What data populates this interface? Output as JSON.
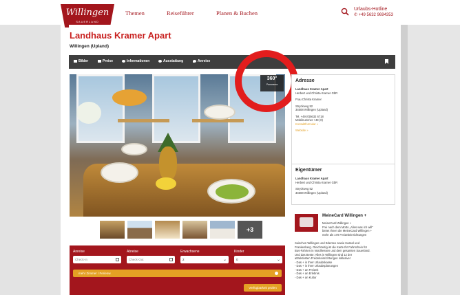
{
  "header": {
    "logo_name": "Willingen",
    "logo_sub": "SAUERLAND",
    "nav": [
      "Themen",
      "Reiseführer",
      "Planen & Buchen"
    ],
    "hotline_label": "Urlaubs-Hotline",
    "hotline_phone": "+49 5632 9694353",
    "icons": {
      "search": "search-icon",
      "phone": "phone-icon"
    }
  },
  "listing": {
    "title": "Landhaus Kramer Apart",
    "location": "Willingen (Upland)"
  },
  "tabs": [
    {
      "label": "Bilder",
      "icon": "image-icon"
    },
    {
      "label": "Preise",
      "icon": "price-icon"
    },
    {
      "label": "Informationen",
      "icon": "info-icon"
    },
    {
      "label": "Ausstattung",
      "icon": "settings-icon"
    },
    {
      "label": "Anreise",
      "icon": "location-icon"
    }
  ],
  "gallery": {
    "panorama_label": "360°",
    "panorama_sub": "Panorama",
    "more_count": "+3"
  },
  "booking": {
    "labels": [
      "Anreise",
      "Abreise",
      "Erwachsene",
      "Kinder"
    ],
    "checkin_placeholder": "Check-In",
    "checkout_placeholder": "Check-Out",
    "adults_value": "2",
    "children_value": "0",
    "more_rooms": "mehr Zimmer / Ferienw.",
    "check_button": "Verfügbarkeit prüfen"
  },
  "address": {
    "heading": "Adresse",
    "lines": [
      "Landhaus Kramer Apart",
      "Herbert und Christa Kramer GbR",
      "",
      "Frau Christa Kramer",
      "",
      "Stryckweg 52",
      "34508 Willingen (Upland)",
      "",
      "Tel. +49 (0)5632 6718",
      "Mobilnummer +49 (0)",
      "Kontaktformular »",
      "",
      "Website »"
    ]
  },
  "owner": {
    "heading": "Eigentümer",
    "lines": [
      "Landhaus Kramer Apart",
      "Herbert und Christa Kramer GbR",
      "",
      "Stryckweg 52",
      "34508 Willingen (Upland)"
    ]
  },
  "card": {
    "heading": "MeineCard Willingen +",
    "intro": [
      "MeineCard Willingen +",
      "Frei nach dem Motto „Alles was ich will\"",
      "bietet Ihnen die MeineCard Willingen +",
      "mehr als 170 Freizeiteinrichtungen"
    ],
    "body": [
      "zwischen Willingen und Edersee sowie Kassel und",
      "Frankenberg. Gleichzeitig ist die Karte Ihr Fahrschein für",
      "Bus-Fahrten in Nordhessen und dem gesamten Sauerland.",
      "Und das Beste: Alles in Willingen sind 12 der",
      "attraktivsten Freizeiteinrichtungen inklusive!",
      "- Das + in Ihrer Urlaubskasse",
      "- Das + in Ihrer Urlaubsplanungen",
      "- Das + an Freizeit",
      "- Das + an Erlebnis",
      "- Das + an Kultur"
    ]
  },
  "colors": {
    "brand_red": "#a3161d",
    "title_red": "#c8201f",
    "accent_orange": "#e4a124",
    "tabbar": "#3e3e3e",
    "annotation_circle": "#e21d1d"
  }
}
